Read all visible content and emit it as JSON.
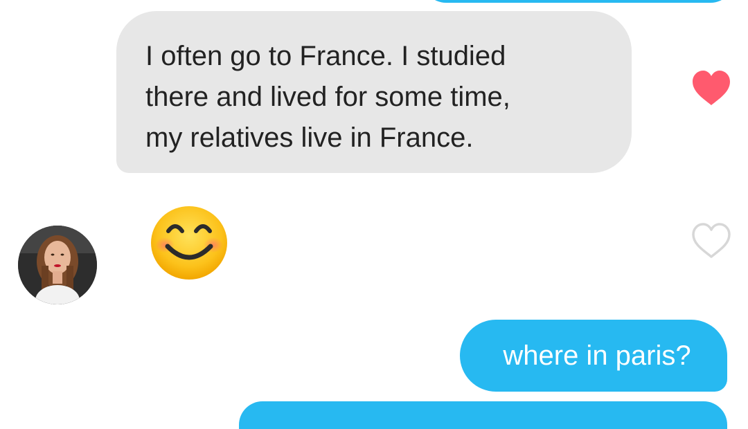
{
  "conversation": {
    "messages": [
      {
        "direction": "received",
        "text": "I often go to France. I studied\nthere and lived for some time,\nmy relatives live in France.",
        "liked": true
      },
      {
        "direction": "received",
        "type": "emoji",
        "emoji_name": "smiling-face-with-smiling-eyes",
        "liked": false
      },
      {
        "direction": "sent",
        "text": "where in paris?"
      }
    ]
  },
  "colors": {
    "sent_bubble": "#27b9f1",
    "received_bubble": "#e7e7e7",
    "like_heart": "#ff5a6e",
    "empty_heart_outline": "#d7d7d7",
    "received_text": "#222222",
    "sent_text": "#ffffff"
  },
  "icons": {
    "liked_heart": "heart-filled-icon",
    "unliked_heart": "heart-outline-icon",
    "emoji": "smiling-face-emoji"
  }
}
